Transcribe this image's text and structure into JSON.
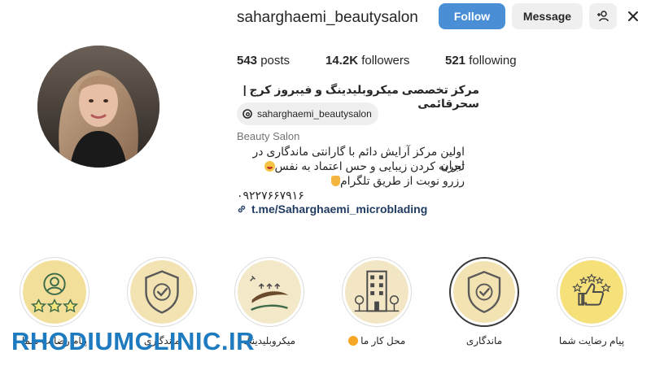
{
  "profile": {
    "username": "saharghaemi_beautysalon",
    "follow_label": "Follow",
    "message_label": "Message",
    "suggest_icon": "add-person-icon",
    "more_icon": "close-icon",
    "avatar_icon": "profile-photo"
  },
  "stats": {
    "posts_count": "543",
    "posts_label": "posts",
    "followers_count": "14.2K",
    "followers_label": "followers",
    "following_count": "521",
    "following_label": "following"
  },
  "bio": {
    "full_name": "مرکز تخصصی میکروبلیدینگ و فیبروز کرج |سحرقائمی",
    "threads_handle": "saharghaemi_beautysalon",
    "category": "Beauty Salon",
    "line1": "اولین مرکز آرایش دائم با گارانتی ماندگاری در ایران",
    "line2": "تجربه کردن زیبایی و حس اعتماد به نفس",
    "line3": "رزرو نوبت از طریق تلگرام",
    "line4": "۰۹۲۲۷۶۶۷۹۱۶",
    "link": "t.me/Saharghaemi_microblading"
  },
  "highlights": [
    {
      "label": "پیام رضایت شما",
      "icon": "customer-rating-icon"
    },
    {
      "label": "ماندگاری",
      "icon": "shield-check-icon"
    },
    {
      "label": "میکروبلیدینگ",
      "icon": "eyebrow-icon"
    },
    {
      "label": "محل کار ما",
      "icon": "building-icon"
    },
    {
      "label": "ماندگاری",
      "icon": "shield-check-icon"
    },
    {
      "label": "پیام رضایت شما",
      "icon": "thumbs-up-stars-icon"
    }
  ],
  "watermark": "RHODIUMCLINIC.IR",
  "colors": {
    "follow_blue": "#4a8fd6",
    "button_gray": "#efefef",
    "link": "#1e3a5f",
    "watermark": "#1e7bc0",
    "highlight_gold": "#f4e3a8"
  }
}
